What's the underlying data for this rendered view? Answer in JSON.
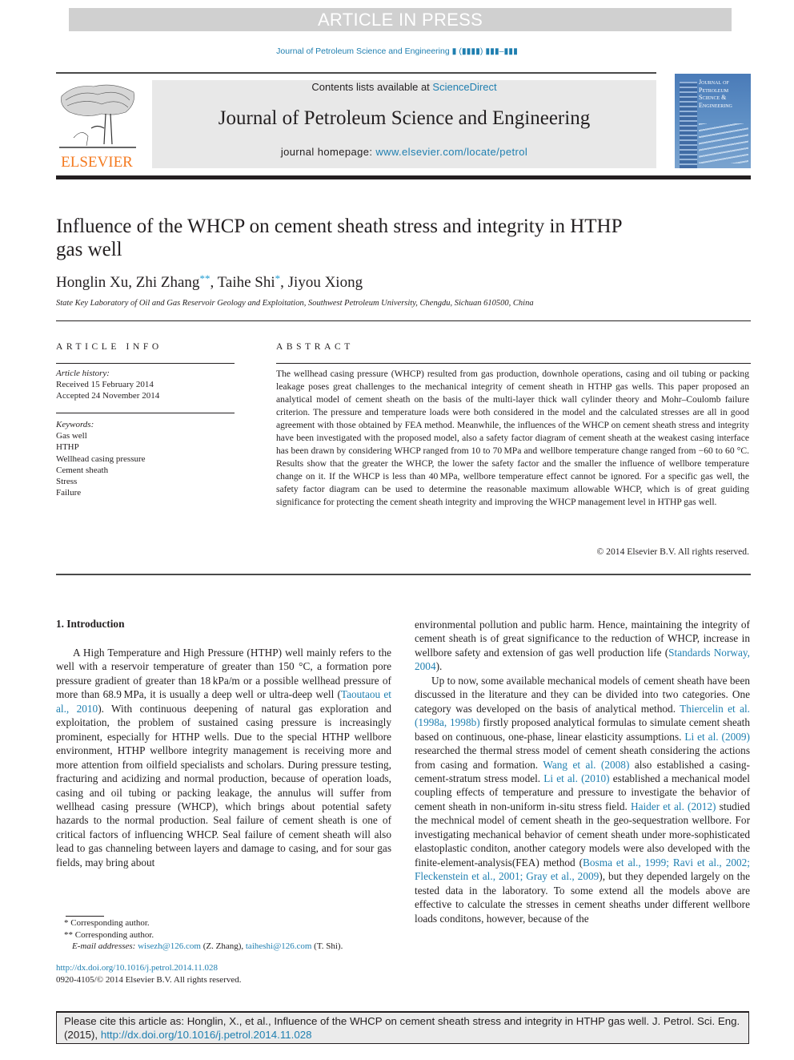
{
  "banner": {
    "status": "ARTICLE IN PRESS"
  },
  "running_head": {
    "journal": "Journal of Petroleum Science and Engineering",
    "volume_placeholder": "▮ (▮▮▮▮) ▮▮▮–▮▮▮"
  },
  "masthead": {
    "publisher_logo_text": "ELSEVIER",
    "contents_prefix": "Contents lists available at ",
    "contents_link": "ScienceDirect",
    "journal_title": "Journal of Petroleum Science and Engineering",
    "homepage_prefix": "journal homepage: ",
    "homepage_link": "www.elsevier.com/locate/petrol",
    "cover_title_lines": [
      "Journal of",
      "Petroleum",
      "Science &",
      "Engineering"
    ]
  },
  "article": {
    "title": "Influence of the WHCP on cement sheath stress and integrity in HTHP gas well",
    "authors": [
      {
        "name": "Honglin Xu",
        "mark": ""
      },
      {
        "name": "Zhi Zhang",
        "mark": "**"
      },
      {
        "name": "Taihe Shi",
        "mark": "*"
      },
      {
        "name": "Jiyou Xiong",
        "mark": ""
      }
    ],
    "affiliation": "State Key Laboratory of Oil and Gas Reservoir Geology and Exploitation, Southwest Petroleum University, Chengdu, Sichuan 610500, China"
  },
  "article_info": {
    "heading": "ARTICLE INFO",
    "history_label": "Article history:",
    "received": "Received 15 February 2014",
    "accepted": "Accepted 24 November 2014",
    "keywords_label": "Keywords:",
    "keywords": [
      "Gas well",
      "HTHP",
      "Wellhead casing pressure",
      "Cement sheath",
      "Stress",
      "Failure"
    ]
  },
  "abstract": {
    "heading": "ABSTRACT",
    "text": "The wellhead casing pressure (WHCP) resulted from gas production, downhole operations, casing and oil tubing or packing leakage poses great challenges to the mechanical integrity of cement sheath in HTHP gas wells. This paper proposed an analytical model of cement sheath on the basis of the multi-layer thick wall cylinder theory and Mohr–Coulomb failure criterion. The pressure and temperature loads were both considered in the model and the calculated stresses are all in good agreement with those obtained by FEA method. Meanwhile, the influences of the WHCP on cement sheath stress and integrity have been investigated with the proposed model, also a safety factor diagram of cement sheath at the weakest casing interface has been drawn by considering WHCP ranged from 10 to 70 MPa and wellbore temperature change ranged from −60 to 60 °C. Results show that the greater the WHCP, the lower the safety factor and the smaller the influence of wellbore temperature change on it. If the WHCP is less than 40 MPa, wellbore temperature effect cannot be ignored. For a specific gas well, the safety factor diagram can be used to determine the reasonable maximum allowable WHCP, which is of great guiding significance for protecting the cement sheath integrity and improving the WHCP management level in HTHP gas well.",
    "copyright": "© 2014 Elsevier B.V. All rights reserved."
  },
  "introduction": {
    "heading": "1.  Introduction",
    "p1_a": "A High Temperature and High Pressure (HTHP) well mainly refers to the well with a reservoir temperature of greater than 150 °C, a formation pore pressure gradient of greater than 18 kPa/m or a possible wellhead pressure of more than 68.9 MPa, it is usually a deep well or ultra-deep well (",
    "p1_cite1": "Taoutaou et al., 2010",
    "p1_b": "). With continuous deepening of natural gas exploration and exploitation, the problem of sustained casing pressure is increasingly prominent, especially for HTHP wells. Due to the special HTHP wellbore environment, HTHP wellbore integrity management is receiving more and more attention from oilfield specialists and scholars. During pressure testing, fracturing and acidizing and normal production, because of operation loads, casing and oil tubing or packing leakage, the annulus will suffer from wellhead casing pressure (WHCP), which brings about potential safety hazards to the normal production. Seal failure of cement sheath is one of critical factors of influencing WHCP. Seal failure of cement sheath will also lead to gas channeling between layers and damage to casing, and for sour gas fields, may bring about environmental pollution and public harm. Hence, maintaining the integrity of cement sheath is of great significance to the reduction of WHCP, increase in wellbore safety and extension of gas well production life (",
    "p1_cite2": "Standards Norway, 2004",
    "p1_c": ").",
    "col1_text_a": "A High Temperature and High Pressure (HTHP) well mainly refers to the well with a reservoir temperature of greater than 150 °C, a formation pore pressure gradient of greater than 18 kPa/m or a possible wellhead pressure of more than 68.9 MPa, it is usually a deep well or ultra-deep well (",
    "col1_text_b": "). With continuous deepening of natural gas exploration and exploitation, the problem of sustained casing pressure is increasingly prominent, especially for HTHP wells. Due to the special HTHP wellbore environment, HTHP wellbore integrity management is receiving more and more attention from oilfield specialists and scholars. During pressure testing, fractur­ing and acidizing and normal production, because of operation loads, casing and oil tubing or packing leakage, the annulus will suffer from wellhead casing pressure (WHCP), which brings about potential safety hazards to the normal production. Seal failure of cement sheath is one of critical factors of influencing WHCP. Seal failure of cement sheath will also lead to gas channeling between layers and damage to casing, and for sour gas fields, may bring about",
    "col2_text_a": "environmental pollution and public harm. Hence, maintaining the integrity of cement sheath is of great significance to the reduction of WHCP, increase in wellbore safety and extension of gas well production life (",
    "col2_text_b": ").",
    "p2_a": "Up to now, some available mechanical models of cement sheath have been discussed in the literature and they can be divided into two categories. One category was developed on the basis of analytical method. ",
    "p2_cite1": "Thiercelin et al. (1998a, 1998b)",
    "p2_b": " firstly proposed analytical formulas to simulate cement sheath based on continuous, one-phase, linear elasticity assumptions. ",
    "p2_cite2": "Li et al. (2009)",
    "p2_c": " researched the thermal stress model of cement sheath considering the actions from casing and formation. ",
    "p2_cite3": "Wang et al. (2008)",
    "p2_d": " also established a casing-cement-stratum stress model. ",
    "p2_cite4": "Li et al. (2010)",
    "p2_e": " established a mechanical model coupling effects of temperature and pressure to investigate the behavior of cement sheath in non-uniform in-situ stress field. ",
    "p2_cite5": "Haider et al. (2012)",
    "p2_f": " studied the mechnical model of cement sheath in the geo-sequestration wellbore. For investigating mechanical behavior of cement sheath under more-sophisticated elastoplastic conditon, another category models were also developed with the finite-ele­ment-analysis(FEA) method (",
    "p2_cite6": "Bosma et al., 1999; Ravi et al., 2002; Fleckenstein et al., 2001; Gray et al., 2009",
    "p2_g": "), but they depended largely on the tested data in the laboratory. To some extend all the models above are effective to calculate the stresses in cement sheaths under different wellbore loads conditons, however, because of the"
  },
  "footnotes": {
    "fn1": "* Corresponding author.",
    "fn2": "** Corresponding author.",
    "email_label": "E-mail addresses: ",
    "email1": "wisezh@126.com",
    "email1_owner": " (Z. Zhang), ",
    "email2": "taiheshi@126.com",
    "email2_owner": " (T. Shi).",
    "doi": "http://dx.doi.org/10.1016/j.petrol.2014.11.028",
    "issn": "0920-4105/© 2014 Elsevier B.V. All rights reserved."
  },
  "citation_box": {
    "text": "Please cite this article as: Honglin, X., et al., Influence of the WHCP on cement sheath stress and integrity in HTHP gas well. J. Petrol. Sci. Eng. (2015), ",
    "doi": "http://dx.doi.org/10.1016/j.petrol.2014.11.028"
  },
  "colors": {
    "link": "#1f7fb0",
    "elsevier_orange": "#f47a20",
    "banner_gray": "#d0d0d0",
    "masthead_gray": "#e8e8e8"
  }
}
